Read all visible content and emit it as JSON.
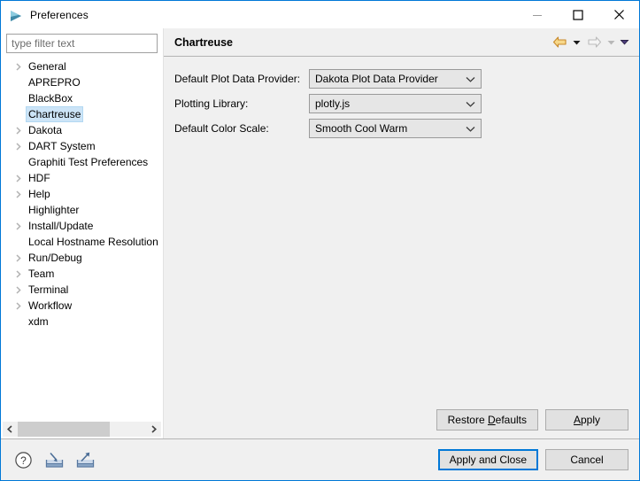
{
  "window": {
    "title": "Preferences",
    "icon": "preferences-app-icon",
    "controls": {
      "minimize": "minimize-icon",
      "maximize": "maximize-icon",
      "close": "close-icon"
    },
    "accent_color": "#0078d7"
  },
  "sidebar": {
    "filter": {
      "value": "",
      "placeholder": "type filter text"
    },
    "items": [
      {
        "label": "General",
        "expandable": true,
        "selected": false
      },
      {
        "label": "APREPRO",
        "expandable": false,
        "selected": false
      },
      {
        "label": "BlackBox",
        "expandable": false,
        "selected": false
      },
      {
        "label": "Chartreuse",
        "expandable": false,
        "selected": true
      },
      {
        "label": "Dakota",
        "expandable": true,
        "selected": false
      },
      {
        "label": "DART System",
        "expandable": true,
        "selected": false
      },
      {
        "label": "Graphiti Test Preferences",
        "expandable": false,
        "selected": false
      },
      {
        "label": "HDF",
        "expandable": true,
        "selected": false
      },
      {
        "label": "Help",
        "expandable": true,
        "selected": false
      },
      {
        "label": "Highlighter",
        "expandable": false,
        "selected": false
      },
      {
        "label": "Install/Update",
        "expandable": true,
        "selected": false
      },
      {
        "label": "Local Hostname Resolution",
        "expandable": false,
        "selected": false
      },
      {
        "label": "Run/Debug",
        "expandable": true,
        "selected": false
      },
      {
        "label": "Team",
        "expandable": true,
        "selected": false
      },
      {
        "label": "Terminal",
        "expandable": true,
        "selected": false
      },
      {
        "label": "Workflow",
        "expandable": true,
        "selected": false
      },
      {
        "label": "xdm",
        "expandable": false,
        "selected": false
      }
    ],
    "scrollbar": {
      "left_arrow": "chevron-left-icon",
      "right_arrow": "chevron-right-icon"
    },
    "selection_color": "#cce4f7"
  },
  "page": {
    "title": "Chartreuse",
    "nav": {
      "back": "back-arrow-icon",
      "back_menu": "caret-down-icon",
      "forward": "forward-arrow-icon",
      "forward_menu": "caret-down-icon",
      "view_menu": "caret-down-icon",
      "back_color": "#e8a33d",
      "forward_color": "#b6b6b6"
    },
    "fields": [
      {
        "label": "Default Plot Data Provider:",
        "value": "Dakota Plot Data Provider",
        "name": "default-plot-data-provider"
      },
      {
        "label": "Plotting Library:",
        "value": "plotly.js",
        "name": "plotting-library"
      },
      {
        "label": "Default Color Scale:",
        "value": "Smooth Cool Warm",
        "name": "default-color-scale"
      }
    ],
    "buttons": {
      "restore_defaults_pre": "Restore ",
      "restore_defaults_key": "D",
      "restore_defaults_post": "efaults",
      "apply_key": "A",
      "apply_post": "pply"
    }
  },
  "footer": {
    "icons": [
      {
        "name": "help-icon",
        "title": "Help"
      },
      {
        "name": "import-icon",
        "title": "Import"
      },
      {
        "name": "export-icon",
        "title": "Export"
      }
    ],
    "apply_and_close": "Apply and Close",
    "cancel": "Cancel"
  }
}
